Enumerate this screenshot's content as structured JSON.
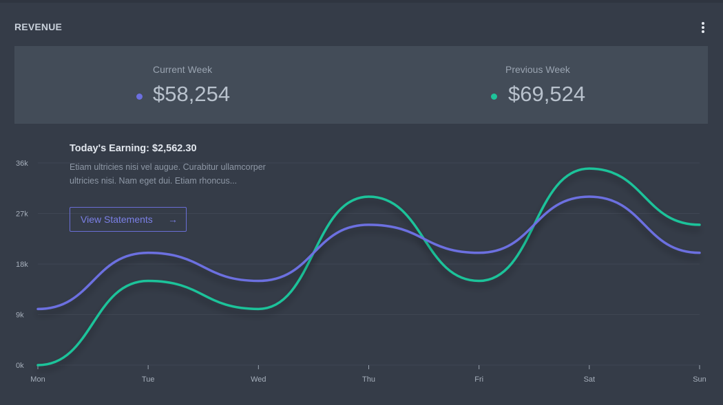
{
  "card": {
    "title": "REVENUE",
    "menu_icon": "vertical-dots-icon"
  },
  "stats": {
    "current": {
      "label": "Current Week",
      "value": "$58,254",
      "color": "#6c6fe0"
    },
    "previous": {
      "label": "Previous Week",
      "value": "$69,524",
      "color": "#1ec39a"
    }
  },
  "overlay": {
    "heading": "Today's Earning: $2,562.30",
    "text": "Etiam ultricies nisi vel augue. Curabitur ullamcorper ultricies nisi. Nam eget dui. Etiam rhoncus...",
    "button_label": "View Statements",
    "button_icon": "arrow-right-icon"
  },
  "chart_data": {
    "type": "line",
    "title": "",
    "xlabel": "",
    "ylabel": "",
    "categories": [
      "Mon",
      "Tue",
      "Wed",
      "Thu",
      "Fri",
      "Sat",
      "Sun"
    ],
    "ylim": [
      0,
      36000
    ],
    "yticks": [
      0,
      9000,
      18000,
      27000,
      36000
    ],
    "ytick_labels": [
      "0k",
      "9k",
      "18k",
      "27k",
      "36k"
    ],
    "grid": true,
    "smooth": true,
    "series": [
      {
        "values": [
          10000,
          20000,
          15000,
          25000,
          20000,
          30000,
          20000
        ],
        "color": "#6c6fe0"
      },
      {
        "values": [
          0,
          15000,
          10000,
          30000,
          15000,
          35000,
          25000
        ],
        "color": "#1ec39a"
      }
    ]
  }
}
